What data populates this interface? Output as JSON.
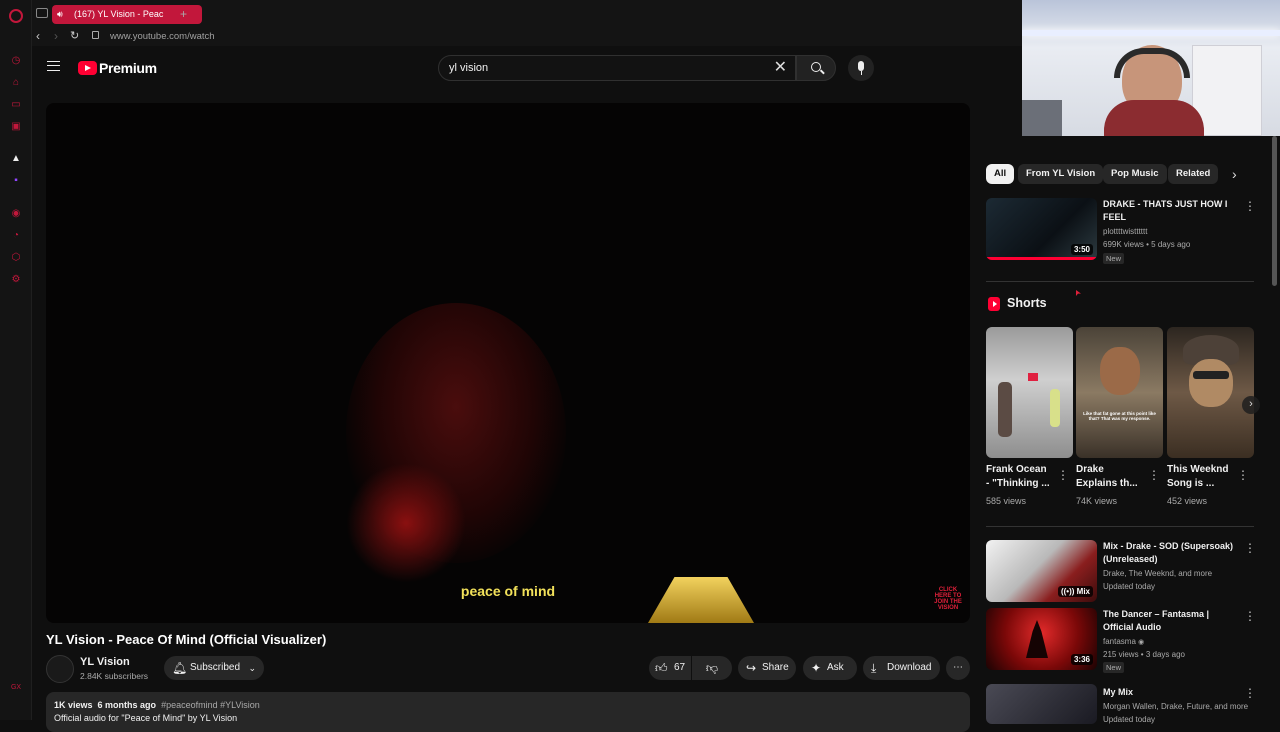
{
  "browser": {
    "tab_title": "(167) YL Vision - Peac",
    "url": "www.youtube.com/watch",
    "side_icons": [
      "opera-logo-icon",
      "history-icon",
      "bag-icon",
      "messenger-icon",
      "box-icon",
      "triangle-icon",
      "twitch-icon",
      "player-icon",
      "clock-icon",
      "cube-icon",
      "settings-icon"
    ],
    "gx_label": "GX"
  },
  "header": {
    "logo_text": "Premium",
    "search_value": "yl vision"
  },
  "player": {
    "subtitle": "peace of mind",
    "watermark": "CLICK HERE TO JOIN THE VISION"
  },
  "video": {
    "title": "YL Vision - Peace Of Mind (Official Visualizer)",
    "channel": "YL Vision",
    "subscribers": "2.84K subscribers",
    "subscribed_label": "Subscribed",
    "likes": "67",
    "share_label": "Share",
    "ask_label": "Ask",
    "download_label": "Download",
    "views": "1K views",
    "age": "6 months ago",
    "tags": "#peaceofmind #YLVision",
    "description_line": "Official audio for \"Peace of Mind\" by YL Vision"
  },
  "chips": [
    "All",
    "From YL Vision",
    "Pop Music",
    "Related"
  ],
  "recommended": [
    {
      "title": "DRAKE - THATS JUST HOW I FEEL",
      "channel": "plottttwistttttt",
      "meta": "699K views • 5 days ago",
      "badge": "New",
      "duration": "3:50"
    }
  ],
  "shorts": {
    "heading": "Shorts",
    "items": [
      {
        "title_l1": "Frank Ocean",
        "title_l2": "- \"Thinking ...",
        "views": "585 views"
      },
      {
        "title_l1": "Drake",
        "title_l2": "Explains th...",
        "views": "74K views"
      },
      {
        "title_l1": "This Weeknd",
        "title_l2": "Song is ...",
        "views": "452 views"
      }
    ],
    "drake_caption": "Like that fat gone at this point like that? That was my response."
  },
  "more": [
    {
      "title_l1": "Mix - Drake - SOD (Supersoak)",
      "title_l2": "(Unreleased)",
      "channel": "Drake, The Weeknd, and more",
      "meta": "Updated today",
      "overlay": "Mix"
    },
    {
      "title_l1": "The Dancer – Fantasma |",
      "title_l2": "Official Audio",
      "channel": "fantasma",
      "meta": "215 views • 3 days ago",
      "badge": "New",
      "duration": "3:36"
    },
    {
      "title_l1": "My Mix",
      "title_l2": "",
      "channel": "Morgan Wallen, Drake, Future, and more",
      "meta": "Updated today"
    }
  ],
  "colors": {
    "accent": "#c2173b",
    "yt_red": "#ff0033",
    "subtitle": "#f2e15a"
  }
}
